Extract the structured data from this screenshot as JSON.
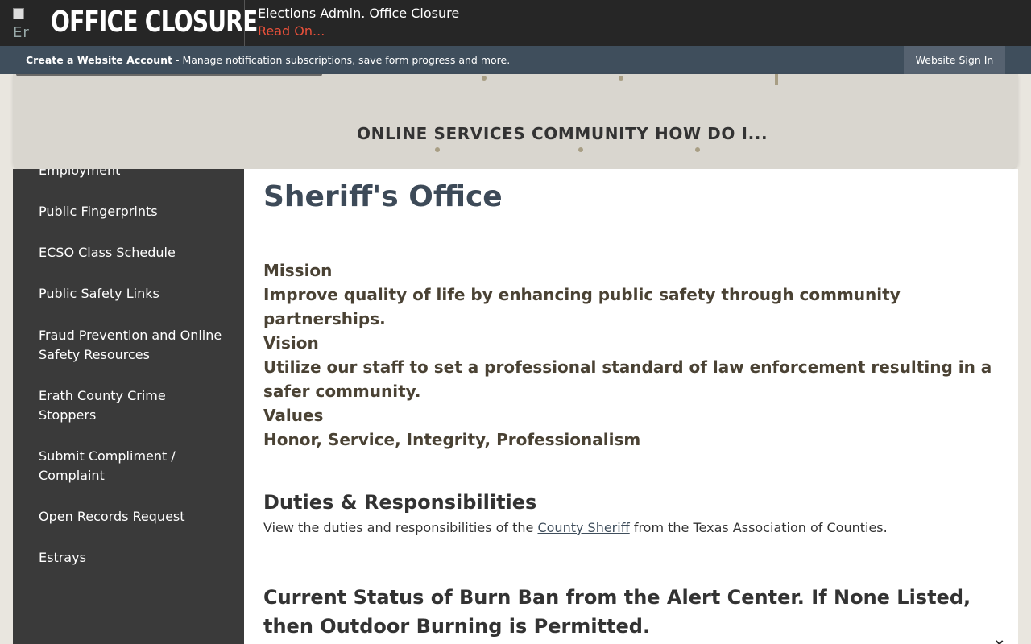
{
  "alert": {
    "logo_alt": "Er",
    "heading": "OFFICE CLOSURE",
    "title": "Elections Admin. Office Closure",
    "link": "Read On..."
  },
  "account": {
    "create_label": "Create a Website Account",
    "description": " - Manage notification subscriptions, save form progress and more.",
    "signin_label": "Website Sign In"
  },
  "nav": {
    "items": [
      "ONLINE SERVICES",
      "COMMUNITY",
      "HOW DO I..."
    ]
  },
  "sidebar": {
    "items": [
      "Employment",
      "Public Fingerprints",
      "ECSO Class Schedule",
      "Public Safety Links",
      "Fraud Prevention and Online Safety Resources",
      "Erath County Crime Stoppers",
      "Submit Compliment / Complaint",
      "Open Records Request",
      "Estrays"
    ]
  },
  "main": {
    "title": "Sheriff's Office",
    "mission_label": "Mission",
    "mission_text": "Improve quality of life by enhancing public safety through community partnerships.",
    "vision_label": "Vision",
    "vision_text": "Utilize our staff to set a professional standard of law enforcement resulting in a safer community.",
    "values_label": "Values",
    "values_text": "Honor, Service, Integrity, Professionalism",
    "duties_heading": "Duties & Responsibilities",
    "duties_prefix": "View the duties and responsibilities of the ",
    "duties_link": "County Sheriff",
    "duties_suffix": " from the Texas Association of Counties.",
    "burn_heading": "Current Status of Burn Ban from the Alert Center. If None Listed, then Outdoor Burning is Permitted."
  },
  "close_icon": "×"
}
